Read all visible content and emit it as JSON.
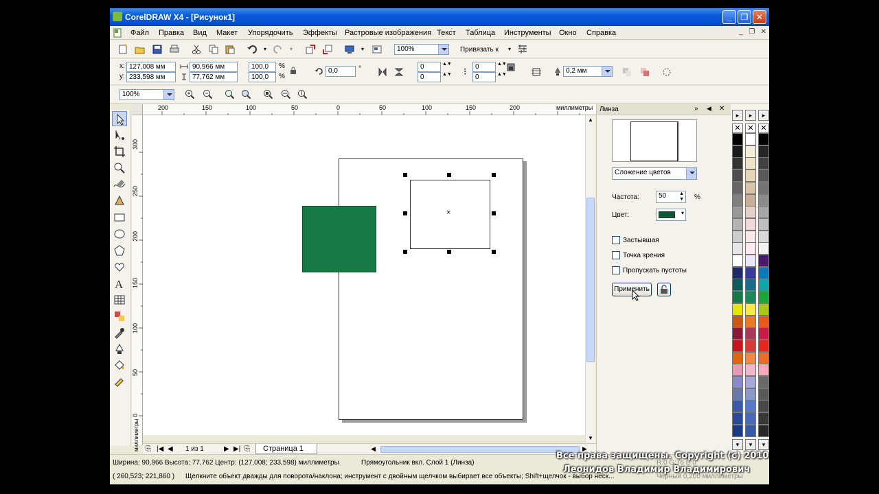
{
  "window": {
    "title": "CorelDRAW X4 - [Рисунок1]"
  },
  "menu": [
    "Файл",
    "Правка",
    "Вид",
    "Макет",
    "Упорядочить",
    "Эффекты",
    "Растровые изображения",
    "Текст",
    "Таблица",
    "Инструменты",
    "Окно",
    "Справка"
  ],
  "standard_toolbar": {
    "zoom_value": "100%",
    "snap_label": "Привязать к"
  },
  "property_bar": {
    "x_label": "x:",
    "y_label": "y:",
    "x_value": "127,008 мм",
    "y_value": "233,598 мм",
    "width_value": "90,966 мм",
    "height_value": "77,762 мм",
    "scale_x": "100,0",
    "scale_y": "100,0",
    "percent": "%",
    "rotation": "0,0",
    "degree": "°",
    "corner_tl": "0",
    "corner_bl": "0",
    "corner_tr": "0",
    "corner_br": "0",
    "outline_width": "0,2 мм"
  },
  "zoom_toolbar": {
    "zoom_value": "100%"
  },
  "ruler": {
    "top_ticks": [
      "200",
      "150",
      "100",
      "50",
      "0",
      "50",
      "100",
      "150",
      "200"
    ],
    "top_units": "миллиметры",
    "left_ticks": [
      "300",
      "250",
      "200",
      "150",
      "100",
      "50",
      "0"
    ],
    "left_units": "миллиметры"
  },
  "page_nav": {
    "page_count": "1 из 1",
    "page_tab": "Страница 1"
  },
  "docker": {
    "title": "Линза",
    "lens_type": "Сложение цветов",
    "rate_label": "Частота:",
    "rate_value": "50",
    "rate_unit": "%",
    "color_label": "Цвет:",
    "lens_color": "#0b5a3a",
    "frozen_label": "Застывшая",
    "viewpoint_label": "Точка зрения",
    "skip_blank_label": "Пропускать пустоты",
    "apply_label": "Применить"
  },
  "canvas": {
    "rect_color": "#157a43"
  },
  "palette": {
    "col1": [
      "#000000",
      "#1a1a1a",
      "#333333",
      "#4d4d4d",
      "#666666",
      "#808080",
      "#999999",
      "#b3b3b3",
      "#cccccc",
      "#e6e6e6",
      "#ffffff",
      "#1f2a6b",
      "#0f5a5a",
      "#137a45",
      "#e6e600",
      "#c85a14",
      "#8a1a3a",
      "#c8141e",
      "#e06414",
      "#e89ab4",
      "#8a8ac8",
      "#6a7aa8",
      "#3a5aa8",
      "#2a4a98",
      "#1a3a88"
    ],
    "col2": [
      "#ffffff",
      "#f2eed8",
      "#ede3c8",
      "#e6d6b8",
      "#d8c4a8",
      "#c8b098",
      "#e4d0c8",
      "#f0d8d8",
      "#f8e8e8",
      "#fce8f0",
      "#e8e8f8",
      "#3a3a98",
      "#1a6a8a",
      "#1a8a5a",
      "#f8e848",
      "#e87a28",
      "#a83a5a",
      "#d83a3a",
      "#f08848",
      "#f0b8c8",
      "#a8a8d8",
      "#8898c8",
      "#5878c8",
      "#4868b8",
      "#3858a8"
    ],
    "col3": [
      "#000000",
      "#262626",
      "#404040",
      "#595959",
      "#737373",
      "#8c8c8c",
      "#a6a6a6",
      "#bfbfbf",
      "#d9d9d9",
      "#f2f2f2",
      "#4a1a6a",
      "#0a7ab8",
      "#0aa8a8",
      "#18a838",
      "#a8c818",
      "#e85a18",
      "#c81a4a",
      "#e8281e",
      "#f06a28",
      "#f8a8b8",
      "#6a6a6a",
      "#585858",
      "#484848",
      "#383838",
      "#282828"
    ]
  },
  "status": {
    "line1": "Ширина: 90,966  Высота: 77,762  Центр: (127,008; 233,598)  миллиметры",
    "object_info": "Прямоугольник вкл. Слой 1  (Линза)",
    "coords": "( 260,523; 221,860 )",
    "hint": "Щелкните объект дважды для поворота/наклона; инструмент с двойным щелчком выбирает все объекты; Shift+щелчок - выбор неск...",
    "fill_info": "R:0 G:76 B:0",
    "outline_info": "Черный  0,200 миллиметры"
  },
  "watermark": {
    "line1": "Все права защищены. Copyright (c) 2010",
    "line2": "Леонидов Владимир Владимирович"
  }
}
